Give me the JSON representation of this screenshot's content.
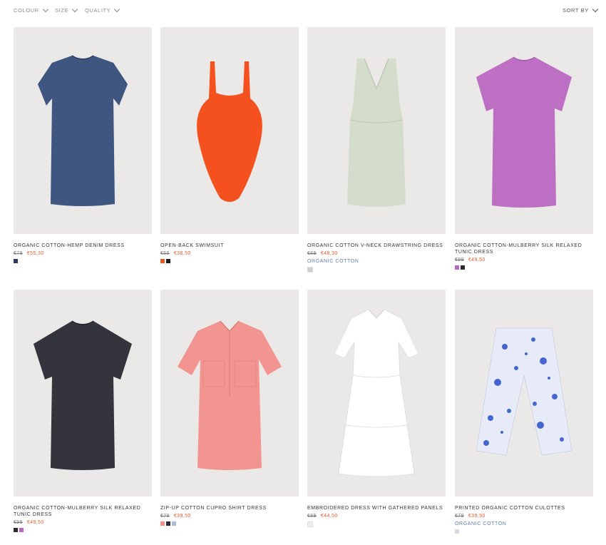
{
  "filters": [
    {
      "label": "COLOUR"
    },
    {
      "label": "SIZE"
    },
    {
      "label": "QUALITY"
    }
  ],
  "sort": {
    "label": "SORT BY"
  },
  "colors": {
    "sale": "#e05a2a",
    "tag": "#5b7fa5",
    "image_bg": "#ebe9e7"
  },
  "products": [
    {
      "name": "ORGANIC COTTON-HEMP DENIM DRESS",
      "old_price": "€79",
      "new_price": "€55,30",
      "tag": "",
      "swatches": [
        "#2b3a5a"
      ],
      "garment_color": "#3f5680"
    },
    {
      "name": "OPEN-BACK SWIMSUIT",
      "old_price": "€55",
      "new_price": "€38,50",
      "tag": "",
      "swatches": [
        "#f0541e",
        "#1a1a1a"
      ],
      "garment_color": "#f4511e"
    },
    {
      "name": "ORGANIC COTTON V-NECK DRAWSTRING DRESS",
      "old_price": "€69",
      "new_price": "€48,30",
      "tag": "ORGANIC COTTON",
      "swatches": [
        "#cfcfcf"
      ],
      "garment_color": "#d4dccc"
    },
    {
      "name": "ORGANIC COTTON-MULBERRY SILK RELAXED TUNIC DRESS",
      "old_price": "€99",
      "new_price": "€49,50",
      "tag": "",
      "swatches": [
        "#b768c0",
        "#2a2a35"
      ],
      "garment_color": "#bd6fc4"
    },
    {
      "name": "ORGANIC COTTON-MULBERRY SILK RELAXED TUNIC DRESS",
      "old_price": "€99",
      "new_price": "€49,50",
      "tag": "",
      "swatches": [
        "#2a2a35",
        "#b768c0"
      ],
      "garment_color": "#33343c"
    },
    {
      "name": "ZIP-UP COTTON CUPRO SHIRT DRESS",
      "old_price": "€79",
      "new_price": "€39,50",
      "tag": "",
      "swatches": [
        "#f08f8c",
        "#2a2a35",
        "#a8bcd8"
      ],
      "garment_color": "#f29590"
    },
    {
      "name": "EMBROIDERED DRESS WITH GATHERED PANELS",
      "old_price": "€89",
      "new_price": "€44,50",
      "tag": "",
      "swatches": [
        "#eeeeee"
      ],
      "garment_color": "#ffffff"
    },
    {
      "name": "PRINTED ORGANIC COTTON CULOTTES",
      "old_price": "€79",
      "new_price": "€39,50",
      "tag": "ORGANIC COTTON",
      "swatches": [
        "#d9d9e8"
      ],
      "garment_color": "#dfe4f2"
    }
  ]
}
